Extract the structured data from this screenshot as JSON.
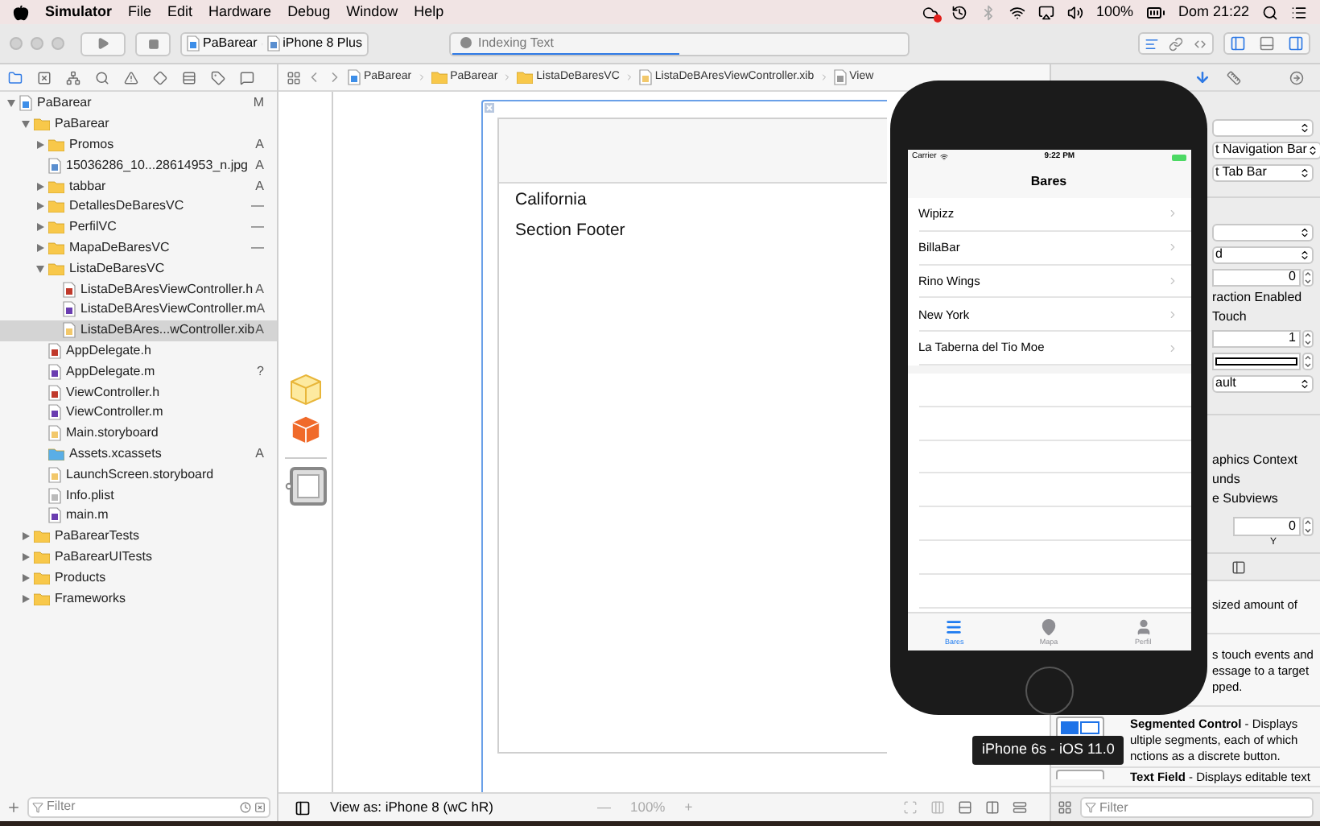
{
  "menu_bar": {
    "app": "Simulator",
    "menus": [
      "File",
      "Edit",
      "Hardware",
      "Debug",
      "Window",
      "Help"
    ],
    "battery": "100%",
    "clock": "Dom 21:22"
  },
  "toolbar": {
    "scheme": "PaBarear",
    "device": "iPhone 8 Plus",
    "activity": "Indexing Text",
    "level": 0.5
  },
  "breadcrumbs": [
    {
      "label": "PaBarear",
      "kind": "project"
    },
    {
      "label": "PaBarear",
      "kind": "folder"
    },
    {
      "label": "ListaDeBaresVC",
      "kind": "folder"
    },
    {
      "label": "ListaDeBAresViewController.xib",
      "kind": "interface"
    },
    {
      "label": "View",
      "kind": "view"
    }
  ],
  "navigator": {
    "filter_placeholder": "Filter",
    "tree": [
      {
        "name": "PaBarear",
        "kind": "project",
        "status": "M",
        "expanded": true,
        "selected": false,
        "children": [
          {
            "name": "PaBarear",
            "kind": "folder",
            "expanded": true,
            "selected": false,
            "children": [
              {
                "name": "Promos",
                "kind": "folder",
                "status": "A",
                "expanded": false,
                "selected": false
              },
              {
                "name": "15036286_10...28614953_n.jpg",
                "kind": "image",
                "status": "A",
                "selected": false
              },
              {
                "name": "tabbar",
                "kind": "folder",
                "status": "A",
                "expanded": false,
                "selected": false
              },
              {
                "name": "DetallesDeBaresVC",
                "kind": "folder",
                "status": "—",
                "expanded": false,
                "selected": false
              },
              {
                "name": "PerfilVC",
                "kind": "folder",
                "status": "—",
                "expanded": false,
                "selected": false
              },
              {
                "name": "MapaDeBaresVC",
                "kind": "folder",
                "status": "—",
                "expanded": false,
                "selected": false
              },
              {
                "name": "ListaDeBaresVC",
                "kind": "folder",
                "expanded": true,
                "selected": false,
                "children": [
                  {
                    "name": "ListaDeBAresViewController.h",
                    "kind": "header",
                    "status": "A",
                    "selected": false
                  },
                  {
                    "name": "ListaDeBAresViewController.m",
                    "kind": "source",
                    "status": "A",
                    "selected": false
                  },
                  {
                    "name": "ListaDeBAres...wController.xib",
                    "kind": "interface",
                    "status": "A",
                    "selected": true
                  }
                ]
              },
              {
                "name": "AppDelegate.h",
                "kind": "header",
                "selected": false
              },
              {
                "name": "AppDelegate.m",
                "kind": "source",
                "status": "?",
                "selected": false
              },
              {
                "name": "ViewController.h",
                "kind": "header",
                "selected": false
              },
              {
                "name": "ViewController.m",
                "kind": "source",
                "selected": false
              },
              {
                "name": "Main.storyboard",
                "kind": "interface",
                "selected": false
              },
              {
                "name": "Assets.xcassets",
                "kind": "assets",
                "status": "A",
                "selected": false
              },
              {
                "name": "LaunchScreen.storyboard",
                "kind": "interface",
                "selected": false
              },
              {
                "name": "Info.plist",
                "kind": "plist",
                "selected": false
              },
              {
                "name": "main.m",
                "kind": "source",
                "selected": false
              }
            ]
          },
          {
            "name": "PaBarearTests",
            "kind": "folder",
            "expanded": false,
            "selected": false
          },
          {
            "name": "PaBarearUITests",
            "kind": "folder",
            "expanded": false,
            "selected": false
          },
          {
            "name": "Products",
            "kind": "folder",
            "expanded": false,
            "selected": false
          },
          {
            "name": "Frameworks",
            "kind": "folder",
            "expanded": false,
            "selected": false
          }
        ]
      }
    ]
  },
  "canvas": {
    "labels": [
      "California",
      "Section Footer"
    ]
  },
  "editor_bar": {
    "view_as": "View as: iPhone 8 (wC hR)",
    "zoom_out": "—",
    "zoom": "100%",
    "zoom_in": "+"
  },
  "inspector": {
    "sections": [
      [
        {
          "kind": "select"
        },
        {
          "kind": "select",
          "text": "t Navigation Bar"
        },
        {
          "kind": "select",
          "text": "t Tab Bar"
        }
      ],
      [
        {
          "kind": "select"
        },
        {
          "kind": "select",
          "text": "d"
        },
        {
          "kind": "stepper",
          "text": "0"
        },
        {
          "kind": "label",
          "text": "raction Enabled"
        },
        {
          "kind": "label",
          "text": "Touch"
        },
        {
          "kind": "stepper",
          "text": "1"
        },
        {
          "kind": "color"
        },
        {
          "kind": "select",
          "text": "ault"
        }
      ],
      [
        {
          "kind": "label",
          "text": "aphics Context"
        },
        {
          "kind": "label",
          "text": "unds"
        },
        {
          "kind": "label",
          "text": "e Subviews"
        },
        {
          "kind": "xy",
          "text": "0",
          "axis": "Y"
        }
      ]
    ],
    "library": [
      {
        "kind": "text",
        "lines": [
          "sized amount of"
        ]
      },
      {
        "kind": "text",
        "lines": [
          "s touch events and",
          "essage to a target",
          "pped."
        ]
      },
      {
        "kind": "segmented-control",
        "lines": [
          "**Segmented Control** - Displays",
          "ultiple segments, each of which",
          "nctions as a discrete button."
        ]
      },
      {
        "kind": "text-field",
        "lines": [
          "**Text Field** - Displays editable text"
        ]
      }
    ],
    "filter_placeholder": "Filter"
  },
  "simulator": {
    "carrier": "Carrier",
    "time": "9:22 PM",
    "title": "Bares",
    "rows": [
      "Wipizz",
      "BillaBar",
      "Rino Wings",
      "New York",
      "La Taberna del Tio Moe"
    ],
    "tabs": [
      {
        "label": "Bares",
        "kind": "list",
        "selected": true
      },
      {
        "label": "Mapa",
        "kind": "pin",
        "selected": false
      },
      {
        "label": "Perfil",
        "kind": "person",
        "selected": false
      }
    ]
  },
  "tooltip": "iPhone 6s - iOS 11.0"
}
